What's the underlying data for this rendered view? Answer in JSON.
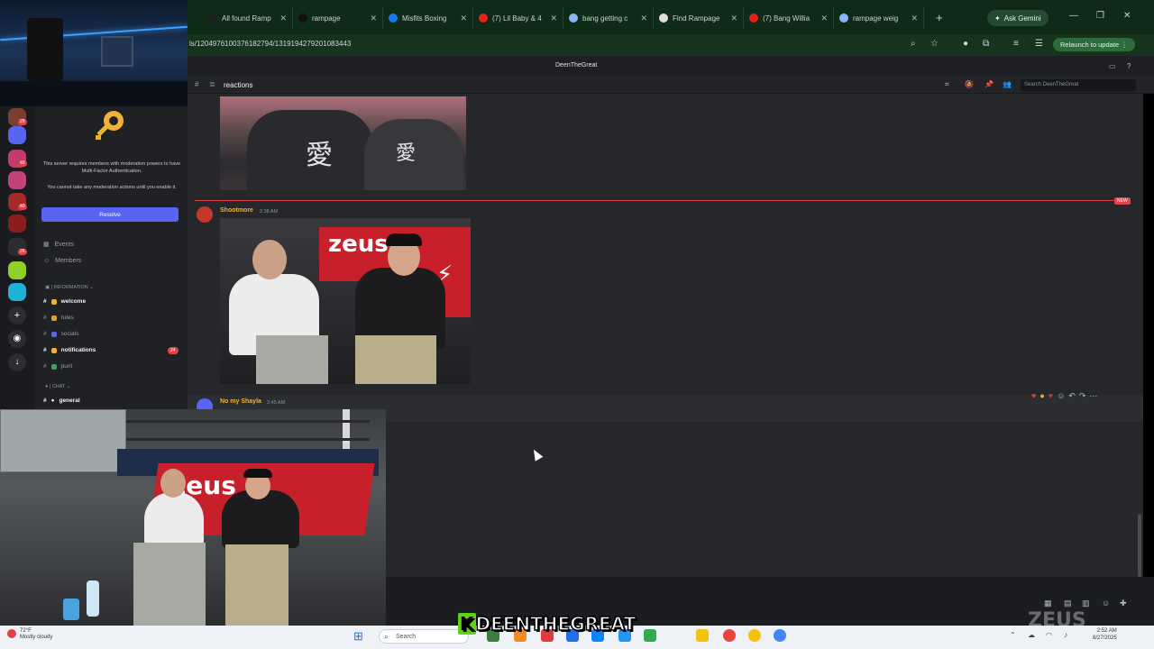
{
  "browser": {
    "tabs": [
      {
        "label": "All found Ramp",
        "color": "#1f1f1f"
      },
      {
        "label": "rampage",
        "color": "#111111"
      },
      {
        "label": "Misfits Boxing",
        "color": "#1877f2"
      },
      {
        "label": "(7) Lil Baby & 4",
        "color": "#e62117"
      },
      {
        "label": "bang getting c",
        "color": "#8ab4f8"
      },
      {
        "label": "Find Rampage",
        "color": "#e0e0e0"
      },
      {
        "label": "(7) Bang Willia",
        "color": "#e62117"
      },
      {
        "label": "rampage weig",
        "color": "#8ab4f8"
      }
    ],
    "new_tab": "+",
    "gemini_label": "Ask Gemini",
    "url": "ls/1204976100376182794/1319194279201083443",
    "relaunch_label": "Relaunch to update"
  },
  "discord": {
    "server_title": "DeenTheGreat",
    "channel_name": "reactions",
    "search_placeholder": "Search DeenTheGreat",
    "new_badge": "NEW",
    "messages": [
      {
        "author": "Shootmore",
        "time": "2:38 AM"
      },
      {
        "author": "No my Shayla",
        "time": "2:45 AM"
      }
    ],
    "sidebar": {
      "mfa_line1": "This server requires members with moderation powers to have Multi-Factor Authentication.",
      "mfa_line2": "You cannot take any moderation actions until you enable it.",
      "resolve_label": "Resolve",
      "events_label": "Events",
      "members_label": "Members",
      "category_info": "INFORMATION",
      "category_chat": "CHAT",
      "channels": [
        {
          "name": "welcome",
          "bold": true,
          "color": "#f0b232"
        },
        {
          "name": "rules",
          "bold": false,
          "color": "#e0a030"
        },
        {
          "name": "socials",
          "bold": false,
          "color": "#5865f2"
        },
        {
          "name": "notifications",
          "bold": true,
          "color": "#f0b232"
        },
        {
          "name": "punt",
          "bold": false,
          "color": "#3ba55d"
        }
      ],
      "general_label": "general",
      "notif_badge": "24"
    },
    "server_badges": [
      "29",
      "40",
      "40",
      "26"
    ]
  },
  "image_text": {
    "kanji": "愛",
    "zeus": "zeus"
  },
  "taskbar": {
    "weather_temp": "72°F",
    "weather_desc": "Mostly cloudy",
    "search_label": "Search",
    "time": "2:52 AM",
    "date": "8/27/2025"
  },
  "overlay": {
    "watermark_k": "K",
    "watermark_rest": "DEENTHEGREAT",
    "corner_logo": "ZEUS"
  }
}
